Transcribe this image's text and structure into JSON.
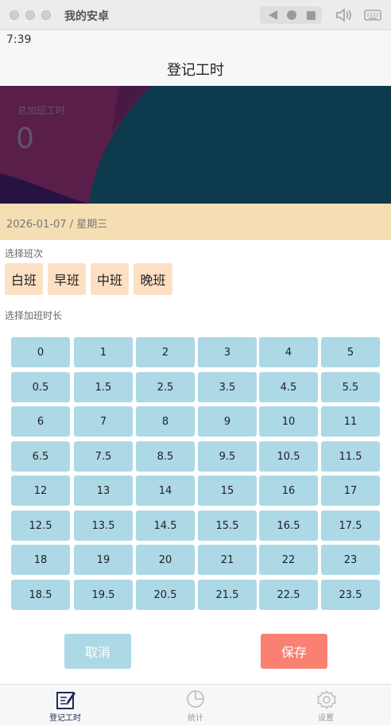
{
  "window": {
    "title": "我的安卓"
  },
  "status": {
    "time": "7:39"
  },
  "header": {
    "title": "登记工时"
  },
  "banner": {
    "label": "总加班工时",
    "value": "0"
  },
  "date": {
    "text": "2026-01-07 / 星期三"
  },
  "shift_section": {
    "label": "选择班次",
    "shifts": [
      "白班",
      "早班",
      "中班",
      "晚班"
    ]
  },
  "hours_section": {
    "label": "选择加班时长",
    "options": [
      "0",
      "1",
      "2",
      "3",
      "4",
      "5",
      "0.5",
      "1.5",
      "2.5",
      "3.5",
      "4.5",
      "5.5",
      "6",
      "7",
      "8",
      "9",
      "10",
      "11",
      "6.5",
      "7.5",
      "8.5",
      "9.5",
      "10.5",
      "11.5",
      "12",
      "13",
      "14",
      "15",
      "16",
      "17",
      "12.5",
      "13.5",
      "14.5",
      "15.5",
      "16.5",
      "17.5",
      "18",
      "19",
      "20",
      "21",
      "22",
      "23",
      "18.5",
      "19.5",
      "20.5",
      "21.5",
      "22.5",
      "23.5"
    ]
  },
  "actions": {
    "cancel_label": "取消",
    "save_label": "保存"
  },
  "tabs": [
    {
      "label": "登记工时",
      "icon": "edit-icon",
      "active": true
    },
    {
      "label": "统计",
      "icon": "pie-chart-icon",
      "active": false
    },
    {
      "label": "设置",
      "icon": "gear-icon",
      "active": false
    }
  ],
  "colors": {
    "hour_button": "#add8e6",
    "shift_button": "#fde0c4",
    "save_button": "#fa8072",
    "date_bar": "#f5deb3",
    "banner_bg": "#0d3a4c",
    "banner_accent": "#5a1e4a"
  }
}
